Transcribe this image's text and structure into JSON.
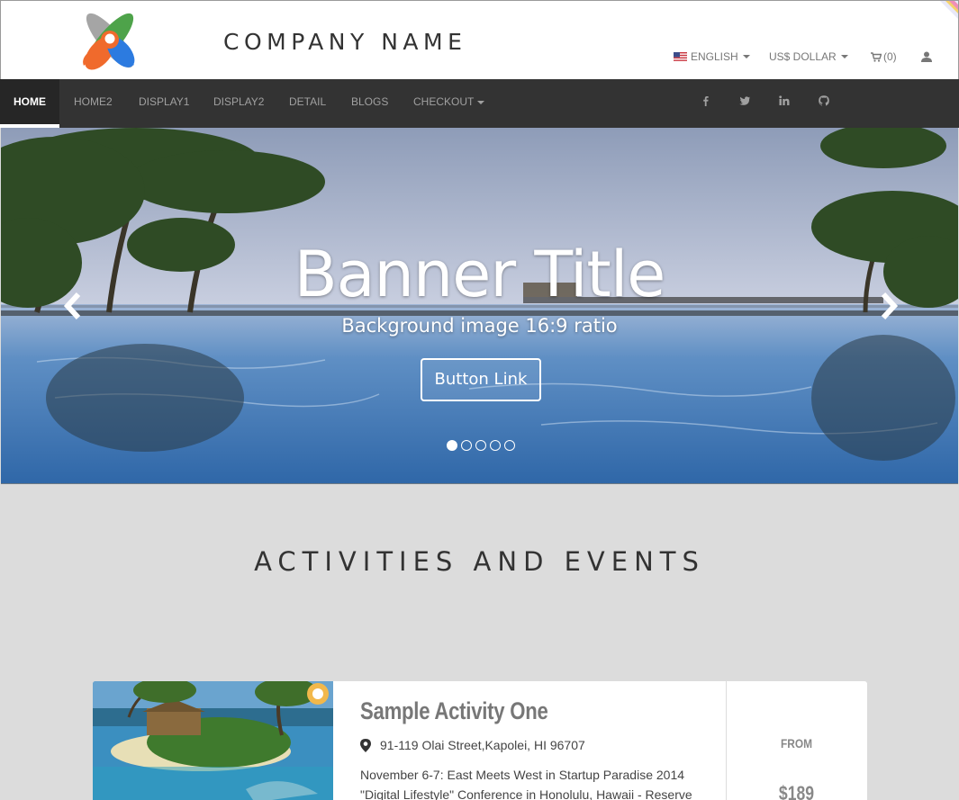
{
  "header": {
    "company_name": "COMPANY NAME",
    "language": "ENGLISH",
    "currency": "US$ DOLLAR",
    "cart": "(0)"
  },
  "nav": {
    "items": [
      {
        "label": "HOME",
        "active": true
      },
      {
        "label": "HOME2"
      },
      {
        "label": "DISPLAY1"
      },
      {
        "label": "DISPLAY2"
      },
      {
        "label": "DETAIL"
      },
      {
        "label": "BLOGS"
      },
      {
        "label": "CHECKOUT"
      }
    ],
    "social": [
      "facebook-icon",
      "twitter-icon",
      "linkedin-icon",
      "github-icon"
    ]
  },
  "banner": {
    "title": "Banner Title",
    "subtitle": "Background image 16:9 ratio",
    "button": "Button Link",
    "slides": 5,
    "active_slide": 1
  },
  "activities": {
    "heading": "ACTIVITIES AND EVENTS",
    "items": [
      {
        "title": "Sample Activity One",
        "address": "91-119 Olai Street,Kapolei, HI 96707",
        "description": "November 6-7: East Meets West in Startup Paradise 2014 \"Digital Lifestyle\" Conference in Honolulu, Hawaii - Reserve",
        "from_label": "FROM",
        "price": "$189"
      }
    ]
  },
  "colors": {
    "navbar": "#333333",
    "page_bg": "#dcdcdc",
    "text_dark": "#333333"
  }
}
